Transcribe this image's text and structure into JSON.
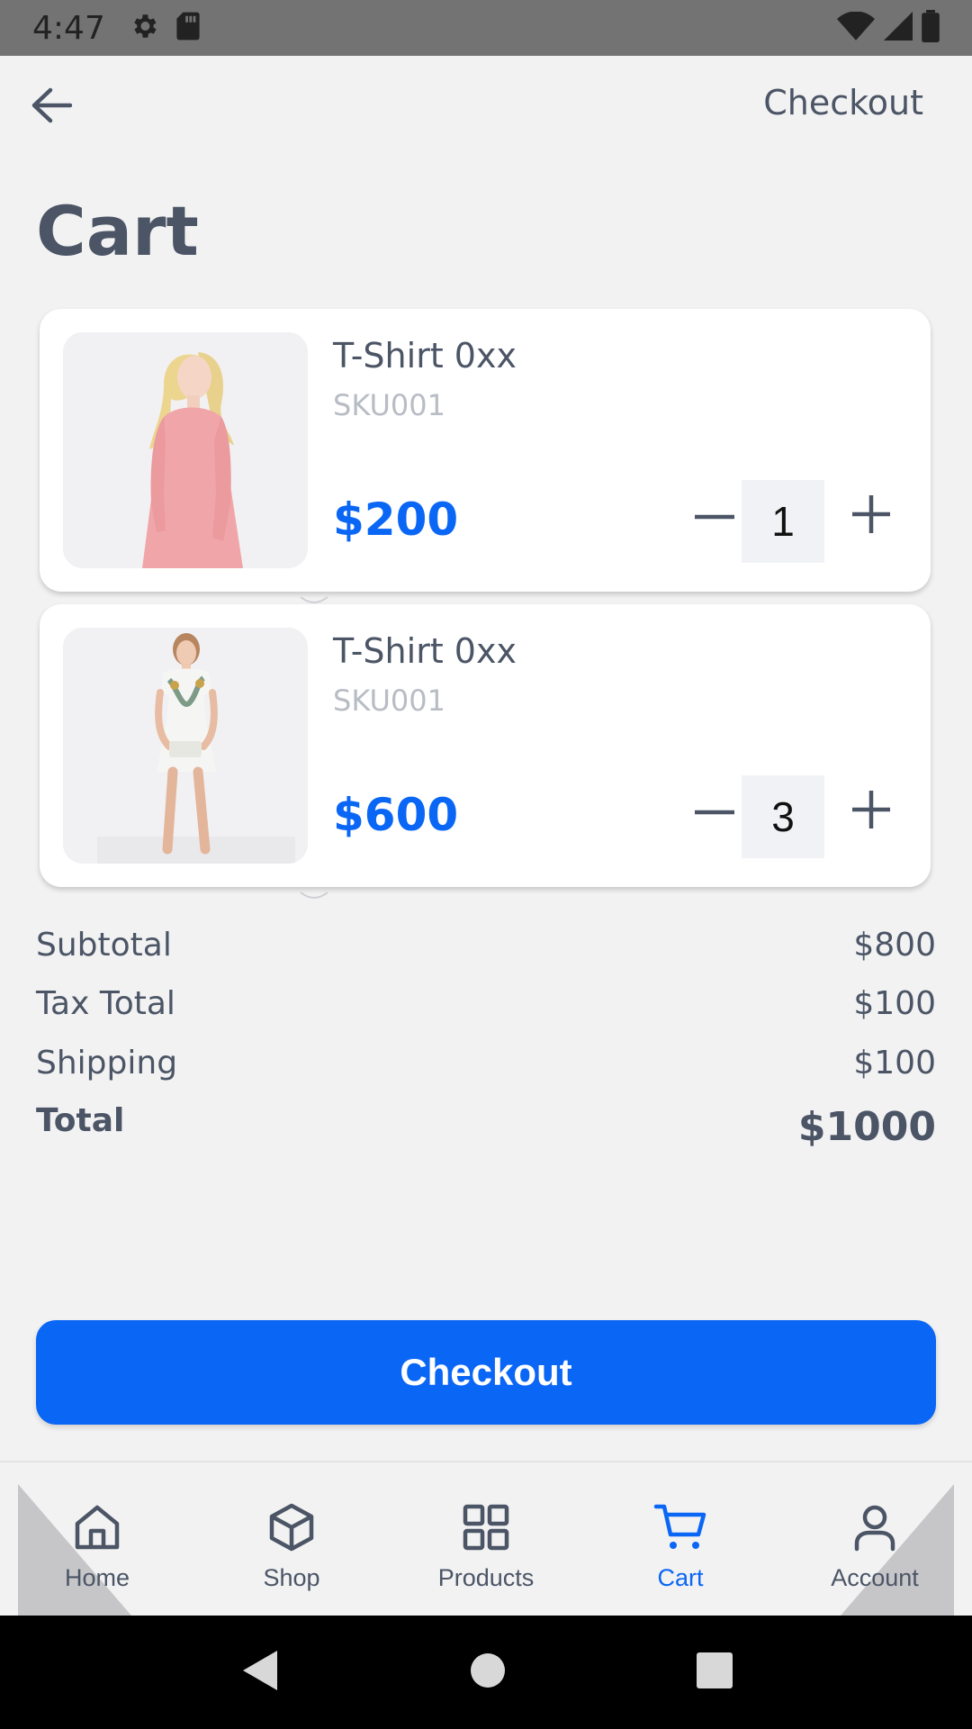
{
  "status_bar": {
    "time": "4:47",
    "icons_left": [
      "gear-icon",
      "sd-card-icon"
    ],
    "icons_right": [
      "wifi-icon",
      "signal-icon",
      "battery-icon"
    ]
  },
  "header": {
    "back_icon": "arrow-left-icon",
    "checkout_link": "Checkout"
  },
  "page_title": "Cart",
  "cart_items": [
    {
      "name": "T-Shirt 0xx",
      "sku": "SKU001",
      "price": "$200",
      "quantity": "1",
      "image": "woman in pink long-sleeve dress"
    },
    {
      "name": "T-Shirt 0xx",
      "sku": "SKU001",
      "price": "$600",
      "quantity": "3",
      "image": "woman in white floral dress"
    }
  ],
  "summary": {
    "subtotal_label": "Subtotal",
    "subtotal_value": "$800",
    "tax_label": "Tax Total",
    "tax_value": "$100",
    "shipping_label": "Shipping",
    "shipping_value": "$100",
    "total_label": "Total",
    "total_value": "$1000"
  },
  "checkout_button": "Checkout",
  "bottom_nav": {
    "items": [
      {
        "label": "Home",
        "icon": "home-icon",
        "active": false
      },
      {
        "label": "Shop",
        "icon": "box-icon",
        "active": false
      },
      {
        "label": "Products",
        "icon": "grid-icon",
        "active": false
      },
      {
        "label": "Cart",
        "icon": "cart-icon",
        "active": true
      },
      {
        "label": "Account",
        "icon": "user-icon",
        "active": false
      }
    ]
  },
  "colors": {
    "accent": "#0a66f5",
    "text": "#4b5565",
    "muted": "#b8bcc4",
    "background": "#f2f2f3"
  }
}
